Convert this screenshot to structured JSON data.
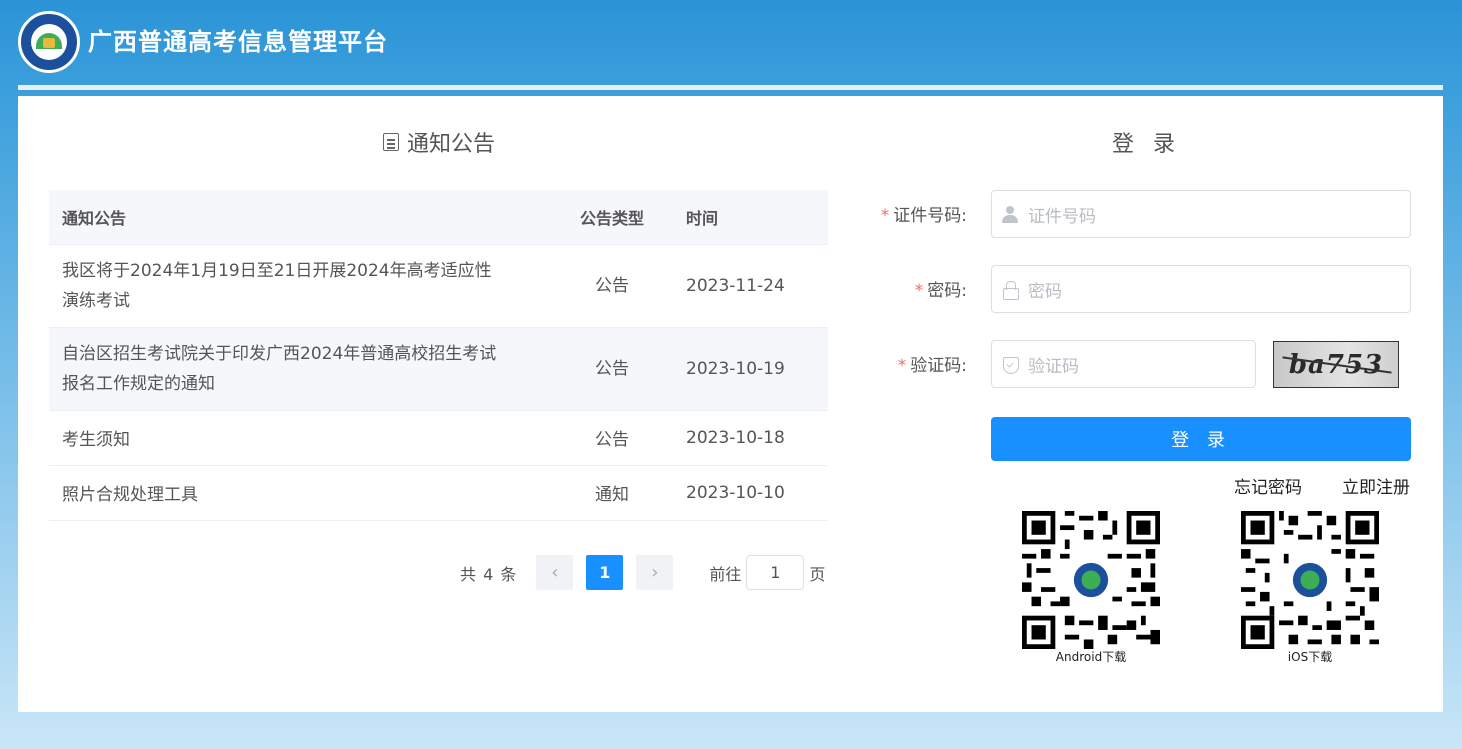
{
  "header": {
    "title": "广西普通高考信息管理平台"
  },
  "notices": {
    "section_title": "通知公告",
    "columns": [
      "通知公告",
      "公告类型",
      "时间"
    ],
    "rows": [
      {
        "title_line1": "我区将于2024年1月19日至21日开展2024年高考适应性",
        "title_line2": "演练考试",
        "type": "公告",
        "date": "2023-11-24"
      },
      {
        "title_line1": "自治区招生考试院关于印发广西2024年普通高校招生考试",
        "title_line2": "报名工作规定的通知",
        "type": "公告",
        "date": "2023-10-19"
      },
      {
        "title": "考生须知",
        "type": "公告",
        "date": "2023-10-18"
      },
      {
        "title": "照片合规处理工具",
        "type": "通知",
        "date": "2023-10-10"
      }
    ],
    "pagination": {
      "total_text": "共 4 条",
      "prev": "‹",
      "current_page": "1",
      "next": "›",
      "goto_label": "前往",
      "goto_value": "1",
      "page_suffix": "页"
    }
  },
  "login": {
    "title": "登 录",
    "id_label": "证件号码:",
    "id_placeholder": "证件号码",
    "password_label": "密码:",
    "password_placeholder": "密码",
    "captcha_label": "验证码:",
    "captcha_placeholder": "验证码",
    "captcha_text": "ba753",
    "required_mark": "*",
    "submit_label": "登 录",
    "forgot_password": "忘记密码",
    "register": "立即注册"
  },
  "downloads": {
    "android_caption": "Android下载",
    "ios_caption": "iOS下载"
  },
  "colors": {
    "primary": "#1890ff",
    "header_bg": "#2b93d6",
    "required": "#f56c6c"
  }
}
